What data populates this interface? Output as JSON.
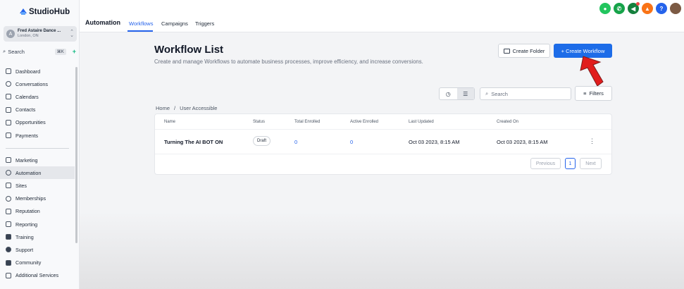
{
  "app": {
    "name": "StudioHub"
  },
  "account": {
    "name": "Fred Astaire Dance ...",
    "location": "London, ON",
    "initial": "A"
  },
  "sidebar": {
    "search_label": "Search",
    "search_shortcut": "⌘K",
    "items": [
      {
        "label": "Dashboard",
        "icon": "dashboard-icon"
      },
      {
        "label": "Conversations",
        "icon": "chat-icon"
      },
      {
        "label": "Calendars",
        "icon": "calendar-icon"
      },
      {
        "label": "Contacts",
        "icon": "contacts-icon"
      },
      {
        "label": "Opportunities",
        "icon": "funnel-icon"
      },
      {
        "label": "Payments",
        "icon": "payment-icon"
      },
      {
        "label": "Marketing",
        "icon": "send-icon"
      },
      {
        "label": "Automation",
        "icon": "automation-icon",
        "active": true
      },
      {
        "label": "Sites",
        "icon": "sites-icon"
      },
      {
        "label": "Memberships",
        "icon": "membership-icon"
      },
      {
        "label": "Reputation",
        "icon": "star-icon"
      },
      {
        "label": "Reporting",
        "icon": "chart-icon"
      },
      {
        "label": "Training",
        "icon": "book-icon"
      },
      {
        "label": "Support",
        "icon": "support-icon"
      },
      {
        "label": "Community",
        "icon": "community-icon"
      },
      {
        "label": "Additional Services",
        "icon": "cart-icon"
      }
    ]
  },
  "header": {
    "section": "Automation",
    "tabs": [
      {
        "label": "Workflows",
        "active": true
      },
      {
        "label": "Campaigns"
      },
      {
        "label": "Triggers"
      }
    ],
    "icons": [
      {
        "name": "user-icon",
        "color": "#22c55e"
      },
      {
        "name": "phone-icon",
        "color": "#16a34a"
      },
      {
        "name": "megaphone-icon",
        "color": "#15803d"
      },
      {
        "name": "bell-icon",
        "color": "#f97316"
      },
      {
        "name": "help-icon",
        "color": "#2563eb"
      },
      {
        "name": "profile-avatar-icon",
        "color": "#7c5a44"
      }
    ]
  },
  "page": {
    "title": "Workflow List",
    "description": "Create and manage Workflows to automate business processes, improve efficiency, and increase conversions.",
    "create_folder": "Create Folder",
    "create_workflow": "+ Create Workflow",
    "search_placeholder": "Search",
    "filters": "Filters",
    "breadcrumb": [
      "Home",
      "/",
      "User Accessible"
    ]
  },
  "table": {
    "columns": [
      "Name",
      "Status",
      "Total Enrolled",
      "Active Enrolled",
      "Last Updated",
      "Created On"
    ],
    "rows": [
      {
        "name": "Turning The AI BOT ON",
        "status": "Draft",
        "total": "0",
        "active": "0",
        "updated": "Oct 03 2023, 8:15 AM",
        "created": "Oct 03 2023, 8:15 AM"
      }
    ]
  },
  "pagination": {
    "previous": "Previous",
    "current": "1",
    "next": "Next"
  },
  "colors": {
    "accent": "#1d6ce8",
    "arrow": "#e11d1d"
  }
}
